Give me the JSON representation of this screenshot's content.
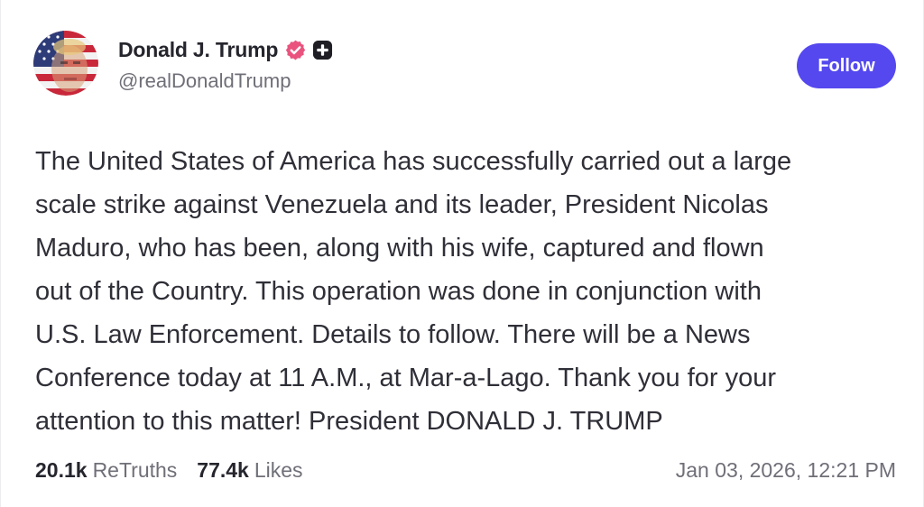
{
  "author": {
    "display_name": "Donald J. Trump",
    "handle": "@realDonaldTrump",
    "avatar": "flag-portrait-avatar",
    "badges": [
      "verified-badge-icon",
      "plus-badge-icon"
    ]
  },
  "follow_button": {
    "label": "Follow"
  },
  "post": {
    "lines": [
      "The United States of America has successfully carried out a large",
      "scale strike against Venezuela and its leader, President Nicolas",
      "Maduro, who has been, along with his wife, captured and flown",
      "out of the Country. This operation was done in conjunction with",
      "U.S. Law Enforcement. Details to follow. There will be a News",
      "Conference today at 11 A.M., at Mar-a-Lago. Thank you for your",
      "attention to this matter! President DONALD J. TRUMP"
    ]
  },
  "stats": {
    "retruths_count": "20.1k",
    "retruths_label": "ReTruths",
    "likes_count": "77.4k",
    "likes_label": "Likes"
  },
  "timestamp": "Jan 03, 2026, 12:21 PM",
  "colors": {
    "accent": "#5448ee",
    "verified": "#e9537e",
    "text_primary": "#25252d",
    "text_secondary": "#6f6f78"
  }
}
